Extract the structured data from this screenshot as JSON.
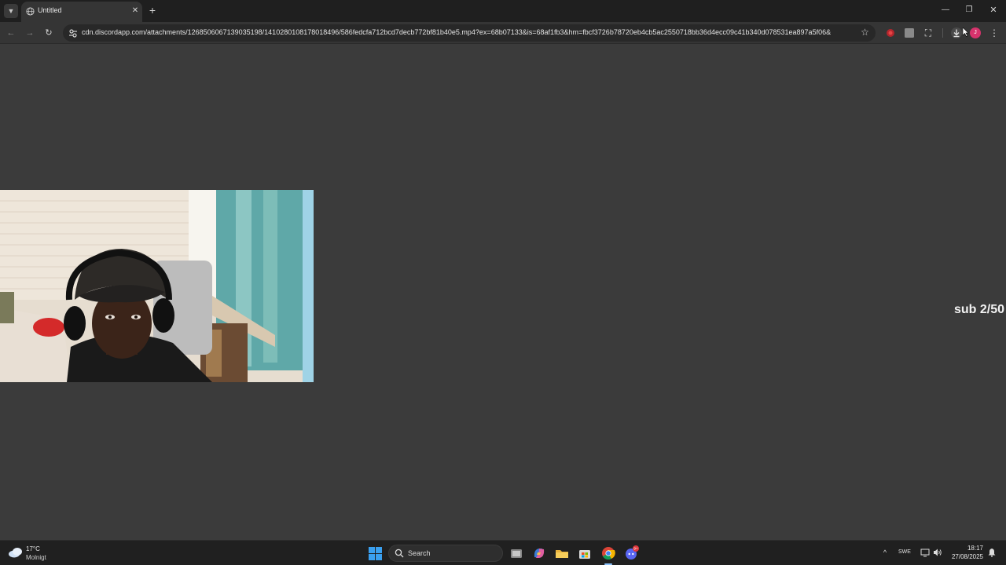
{
  "browser": {
    "tab": {
      "title": "Untitled",
      "favicon": "globe-icon"
    },
    "url": "cdn.discordapp.com/attachments/1268506067139035198/1410280108178018496/586fedcfa712bcd7decb772bf81b40e5.mp4?ex=68b07133&is=68af1fb3&hm=fbcf3726b78720eb4cb5ac2550718bb36d4ecc09c41b340d078531ea897a5f06&",
    "profile_initial": "J",
    "accent": "#d6336c"
  },
  "page": {
    "overlay_text": "sub 2/50",
    "background": "#3b3b3b"
  },
  "taskbar": {
    "weather": {
      "temp": "17°C",
      "desc": "Molnigt"
    },
    "search_label": "Search",
    "tray": {
      "language": "SWE"
    },
    "clock": {
      "time": "18:17",
      "date": "27/08/2025"
    },
    "discord_badge": "9+"
  }
}
